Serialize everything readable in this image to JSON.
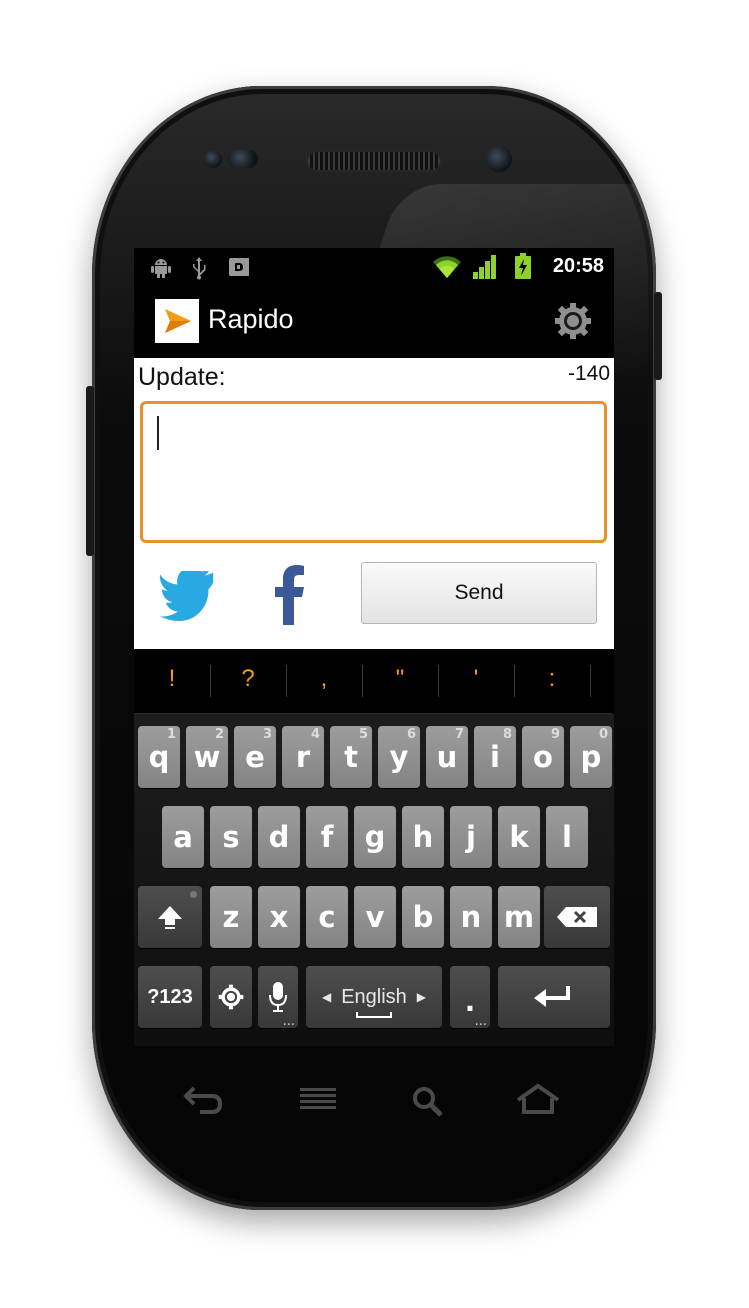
{
  "status_bar": {
    "time": "20:58",
    "icons": [
      "android-debug-icon",
      "usb-icon",
      "sd-card-icon",
      "wifi-icon",
      "signal-icon",
      "battery-charging-icon"
    ]
  },
  "app_bar": {
    "title": "Rapido",
    "logo_icon": "paper-plane-icon",
    "settings_icon": "gear-icon"
  },
  "composer": {
    "label": "Update:",
    "char_counter": "-140",
    "text_value": "",
    "twitter_icon": "twitter-bird-icon",
    "facebook_icon": "facebook-f-icon",
    "send_label": "Send"
  },
  "suggestions": [
    "!",
    "?",
    ",",
    "\"",
    "'",
    ":"
  ],
  "keyboard": {
    "row1": [
      {
        "label": "q",
        "hint": "1"
      },
      {
        "label": "w",
        "hint": "2"
      },
      {
        "label": "e",
        "hint": "3"
      },
      {
        "label": "r",
        "hint": "4"
      },
      {
        "label": "t",
        "hint": "5"
      },
      {
        "label": "y",
        "hint": "6"
      },
      {
        "label": "u",
        "hint": "7"
      },
      {
        "label": "i",
        "hint": "8"
      },
      {
        "label": "o",
        "hint": "9"
      },
      {
        "label": "p",
        "hint": "0"
      }
    ],
    "row2": [
      "a",
      "s",
      "d",
      "f",
      "g",
      "h",
      "j",
      "k",
      "l"
    ],
    "row3": [
      "z",
      "x",
      "c",
      "v",
      "b",
      "n",
      "m"
    ],
    "shift_icon": "shift-arrow-icon",
    "backspace_icon": "backspace-icon",
    "symbols_label": "?123",
    "settings_icon": "gear-icon",
    "mic_icon": "microphone-icon",
    "space_label": "English",
    "period_label": ".",
    "enter_icon": "enter-arrow-icon",
    "more_dots": "..."
  },
  "nav_bar": {
    "icons": [
      "back-icon",
      "menu-icon",
      "search-icon",
      "home-icon"
    ]
  },
  "colors": {
    "accent_orange": "#e6912a",
    "twitter_blue": "#29a9e1",
    "facebook_blue": "#3b5998"
  }
}
